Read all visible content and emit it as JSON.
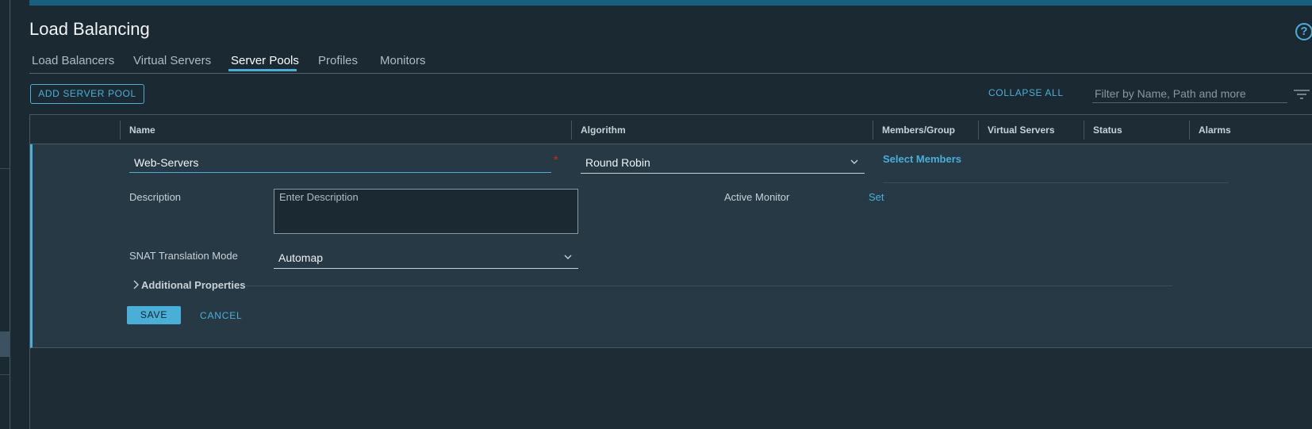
{
  "page": {
    "title": "Load Balancing"
  },
  "tabs": [
    {
      "label": "Load Balancers"
    },
    {
      "label": "Virtual Servers"
    },
    {
      "label": "Server Pools"
    },
    {
      "label": "Profiles"
    },
    {
      "label": "Monitors"
    }
  ],
  "active_tab": "Server Pools",
  "toolbar": {
    "add_label": "ADD SERVER POOL",
    "collapse_label": "COLLAPSE ALL",
    "filter_placeholder": "Filter by Name, Path and more"
  },
  "grid": {
    "columns": [
      "Name",
      "Algorithm",
      "Members/Group",
      "Virtual Servers",
      "Status",
      "Alarms"
    ]
  },
  "form": {
    "name_value": "Web-Servers",
    "required_mark": "*",
    "algorithm_value": "Round Robin",
    "select_members_label": "Select Members",
    "description_label": "Description",
    "description_placeholder": "Enter Description",
    "active_monitor_label": "Active Monitor",
    "set_label": "Set",
    "snat_label": "SNAT Translation Mode",
    "snat_value": "Automap",
    "additional_label": "Additional Properties",
    "save_label": "SAVE",
    "cancel_label": "CANCEL"
  },
  "colors": {
    "accent": "#49afd9",
    "background": "#1b2a32",
    "edit_row": "#263945",
    "required": "#e62700"
  },
  "icons": [
    "help-icon",
    "filter-icon",
    "chevron-down-icon",
    "chevron-right-icon"
  ]
}
